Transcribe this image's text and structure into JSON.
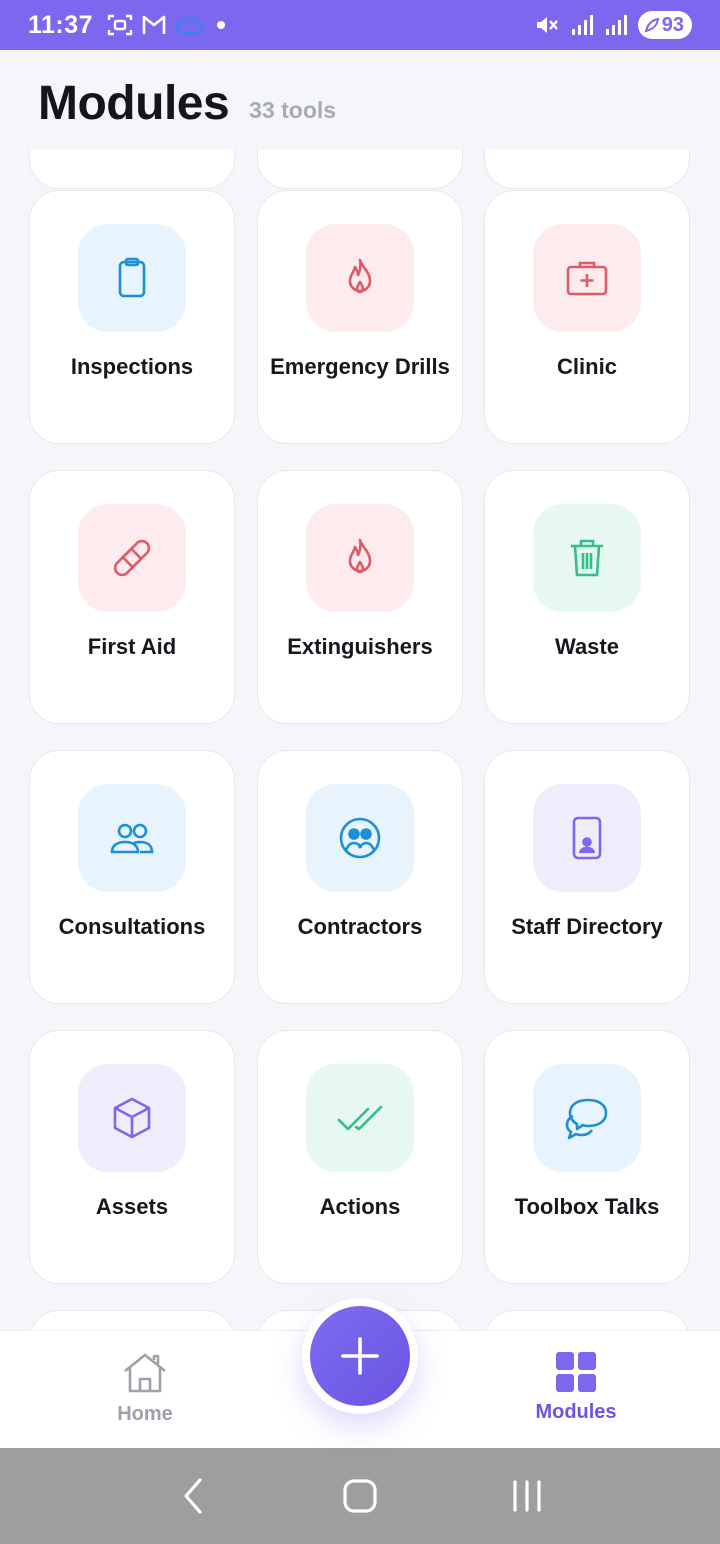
{
  "status_bar": {
    "time": "11:37",
    "battery": "93"
  },
  "header": {
    "title": "Modules",
    "count": "33 tools"
  },
  "colors": {
    "accent": "#7b68ee",
    "blue": "#1d8fd6",
    "blue_bg": "#e7f3fd",
    "red": "#e05a69",
    "red_bg": "#fdebee",
    "green": "#2fbf8a",
    "green_bg": "#e6f8f0",
    "purple": "#7b68ee",
    "purple_bg": "#efedfc"
  },
  "modules": [
    {
      "label": "Inspections",
      "icon": "clipboard-icon",
      "color": "blue"
    },
    {
      "label": "Emergency Drills",
      "icon": "flame-icon",
      "color": "red"
    },
    {
      "label": "Clinic",
      "icon": "medical-kit-icon",
      "color": "red"
    },
    {
      "label": "First Aid",
      "icon": "bandage-icon",
      "color": "red"
    },
    {
      "label": "Extinguishers",
      "icon": "flame-icon",
      "color": "red"
    },
    {
      "label": "Waste",
      "icon": "trash-icon",
      "color": "green"
    },
    {
      "label": "Consultations",
      "icon": "users-icon",
      "color": "blue"
    },
    {
      "label": "Contractors",
      "icon": "user-group-circle-icon",
      "color": "blue"
    },
    {
      "label": "Staff Directory",
      "icon": "phone-contact-icon",
      "color": "purple"
    },
    {
      "label": "Assets",
      "icon": "cube-icon",
      "color": "purple"
    },
    {
      "label": "Actions",
      "icon": "double-check-icon",
      "color": "green"
    },
    {
      "label": "Toolbox Talks",
      "icon": "chat-bubbles-icon",
      "color": "blue"
    }
  ],
  "bottom_nav": {
    "home_label": "Home",
    "modules_label": "Modules"
  }
}
